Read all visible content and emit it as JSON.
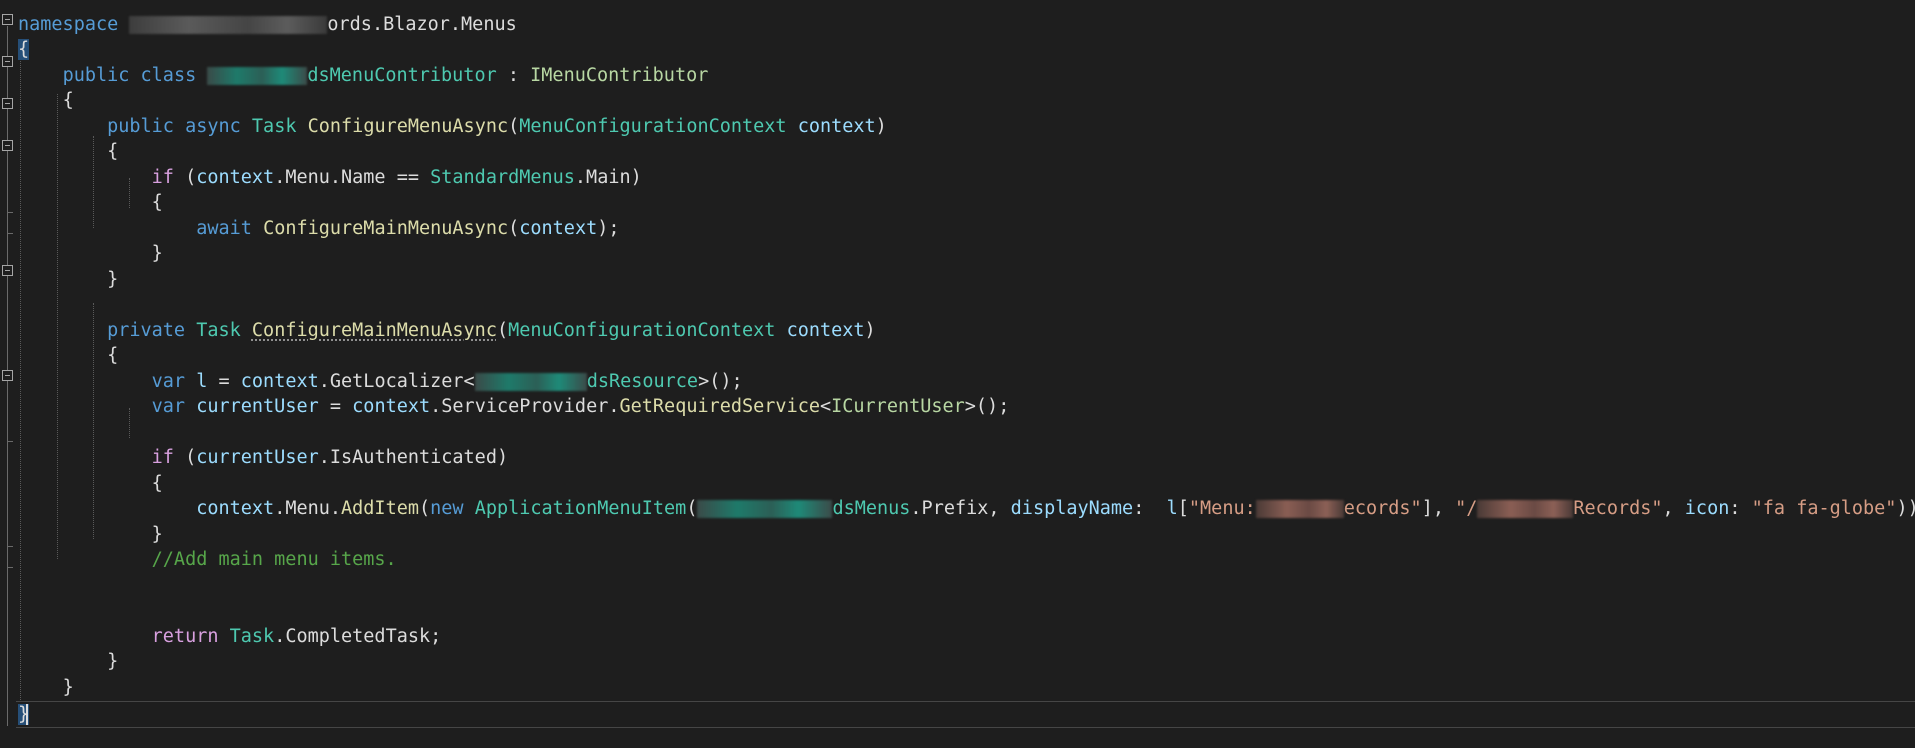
{
  "code": {
    "ns_keyword": "namespace",
    "ns_suffix": "ords.Blazor.Menus",
    "open_brace": "{",
    "close_brace": "}",
    "kw_public": "public",
    "kw_class": "class",
    "class_suffix": "dsMenuContributor",
    "colon": " : ",
    "interface": "IMenuContributor",
    "kw_async": "async",
    "type_task": "Task",
    "method_configure": "ConfigureMenuAsync",
    "paren_open": "(",
    "paren_close": ")",
    "ctx_type": "MenuConfigurationContext",
    "ctx_param": "context",
    "kw_if": "if",
    "ctx_menu_name": ".Menu.Name == ",
    "std_menus": "StandardMenus",
    "main_member": ".Main)",
    "kw_await": "await",
    "method_main": "ConfigureMainMenuAsync",
    "call_end": ");",
    "kw_private": "private",
    "kw_var": "var",
    "var_l": "l",
    "assign": " = ",
    "get_localizer": ".GetLocalizer<",
    "resource_suffix": "dsResource",
    "generic_call_end": ">();",
    "var_current_user": "currentUser",
    "service_provider": ".ServiceProvider.",
    "get_required_service": "GetRequiredService",
    "lt": "<",
    "icurrent_user": "ICurrentUser",
    "is_authenticated": ".IsAuthenticated)",
    "menu_add": ".Menu.",
    "add_item": "AddItem",
    "kw_new": "new",
    "app_menu_item": "ApplicationMenuItem",
    "menus_prefix_suffix": "dsMenus",
    "prefix": ".Prefix, ",
    "display_name": "displayName",
    "display_sep": ":  ",
    "l_bracket": "[",
    "str_menu_prefix": "\"Menu:",
    "str_menu_suffix": "ecords\"",
    "bracket_comma": "], ",
    "str_url_prefix": "\"/",
    "str_url_suffix": "Records\"",
    "comma": ", ",
    "icon_name": "icon",
    "icon_sep": ": ",
    "str_icon": "\"fa fa-globe\"",
    "end_stmt": "));",
    "comment": "//Add main menu items.",
    "kw_return": "return",
    "completed_task": ".CompletedTask;"
  }
}
